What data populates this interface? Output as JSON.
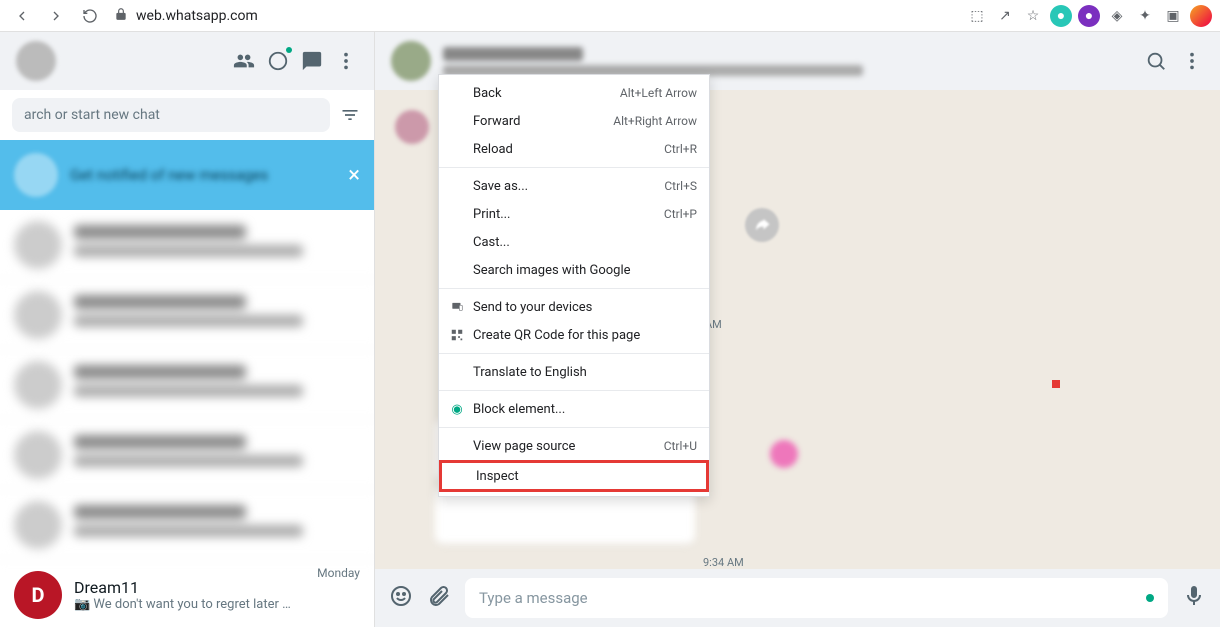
{
  "browser": {
    "url": "web.whatsapp.com"
  },
  "left": {
    "search_placeholder": "arch or start new chat",
    "banner_text": "Get notified of new messages",
    "chat_clear": {
      "name": "Dream11",
      "msg": "📷 We don't want you to regret later 🧍👎 Joi...",
      "time": "Monday"
    }
  },
  "right": {
    "ts1": "AM",
    "ts2": "9:34 AM",
    "composer_placeholder": "Type a message"
  },
  "ctx": {
    "back": "Back",
    "back_sc": "Alt+Left Arrow",
    "forward": "Forward",
    "forward_sc": "Alt+Right Arrow",
    "reload": "Reload",
    "reload_sc": "Ctrl+R",
    "saveas": "Save as...",
    "saveas_sc": "Ctrl+S",
    "print": "Print...",
    "print_sc": "Ctrl+P",
    "cast": "Cast...",
    "searchimg": "Search images with Google",
    "senddev": "Send to your devices",
    "qr": "Create QR Code for this page",
    "translate": "Translate to English",
    "block": "Block element...",
    "viewsrc": "View page source",
    "viewsrc_sc": "Ctrl+U",
    "inspect": "Inspect"
  }
}
